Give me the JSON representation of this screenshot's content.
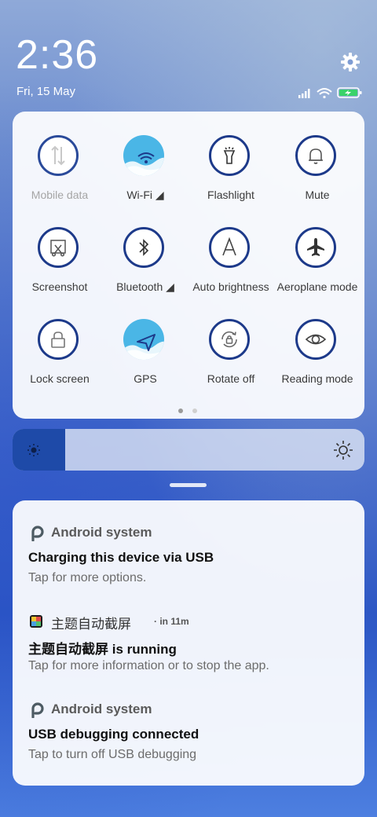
{
  "status": {
    "time": "2:36",
    "date": "Fri, 15 May",
    "icons": [
      "signal-icon",
      "wifi-icon",
      "battery-charging-icon"
    ],
    "settings_icon": "gear-icon"
  },
  "quick_settings": {
    "tiles": [
      {
        "name": "mobile-data",
        "label": "Mobile data",
        "icon": "mobile-data-icon",
        "active": false,
        "disabled": true
      },
      {
        "name": "wifi",
        "label": "Wi-Fi ◢",
        "icon": "wifi-icon",
        "active": true,
        "disabled": false
      },
      {
        "name": "flashlight",
        "label": "Flashlight",
        "icon": "flashlight-icon",
        "active": false,
        "disabled": false
      },
      {
        "name": "mute",
        "label": "Mute",
        "icon": "bell-icon",
        "active": false,
        "disabled": false
      },
      {
        "name": "screenshot",
        "label": "Screenshot",
        "icon": "screenshot-icon",
        "active": false,
        "disabled": false
      },
      {
        "name": "bluetooth",
        "label": "Bluetooth ◢",
        "icon": "bluetooth-icon",
        "active": false,
        "disabled": false
      },
      {
        "name": "auto-brightness",
        "label": "Auto brightness",
        "icon": "auto-brightness-icon",
        "active": false,
        "disabled": false
      },
      {
        "name": "aeroplane-mode",
        "label": "Aeroplane mode",
        "icon": "airplane-icon",
        "active": false,
        "disabled": false
      },
      {
        "name": "lock-screen",
        "label": "Lock screen",
        "icon": "lock-icon",
        "active": false,
        "disabled": false
      },
      {
        "name": "gps",
        "label": "GPS",
        "icon": "location-arrow-icon",
        "active": true,
        "disabled": false
      },
      {
        "name": "rotate-off",
        "label": "Rotate off",
        "icon": "rotation-lock-icon",
        "active": false,
        "disabled": false
      },
      {
        "name": "reading-mode",
        "label": "Reading mode",
        "icon": "eye-icon",
        "active": false,
        "disabled": false
      }
    ],
    "page_count": 2,
    "current_page": 1
  },
  "brightness": {
    "level": 0.15,
    "low_icon": "sun-small-icon",
    "high_icon": "sun-large-icon"
  },
  "notifications": [
    {
      "app": "Android system",
      "meta": "",
      "title": "Charging this device via USB",
      "text": "Tap for more options.",
      "icon": "android-p-icon"
    },
    {
      "app": "主题自动截屏",
      "meta": "· in 11m",
      "title": "主题自动截屏 is running",
      "text": "Tap for more information or to stop the app.",
      "icon": "theme-screenshot-app-icon"
    },
    {
      "app": "Android system",
      "meta": "",
      "title": "USB debugging connected",
      "text": "Tap to turn off USB debugging",
      "icon": "android-p-icon"
    }
  ],
  "colors": {
    "accent_dark": "#1d3a8a",
    "tile_active": "#4ab6e6",
    "brightness_fill": "#1e4aa8",
    "dot_active": "#9a9a9a",
    "dot_inactive": "#d0d0d0"
  }
}
